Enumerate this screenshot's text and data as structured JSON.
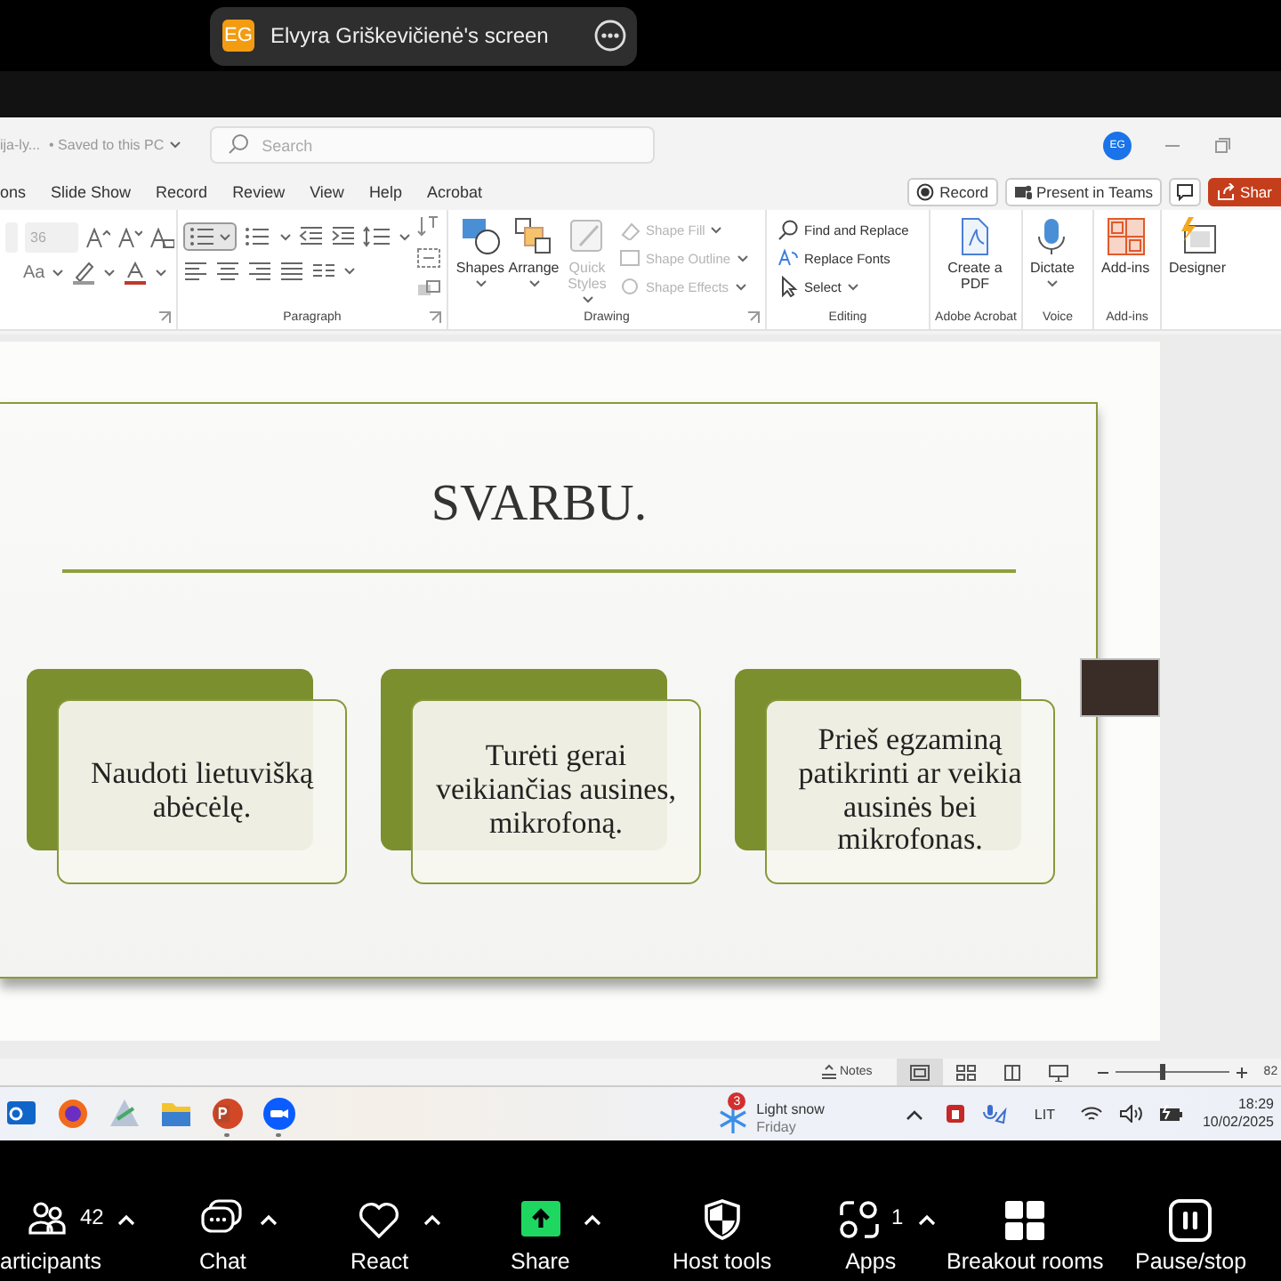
{
  "share_banner": {
    "initials": "EG",
    "title": "Elvyra Griškevičienė's screen"
  },
  "title_bar": {
    "filename": "ija-ly...",
    "save_status": "• Saved to this PC",
    "search": {
      "placeholder": "Search"
    },
    "avatar": "EG"
  },
  "menu_tabs": [
    {
      "label": "ons",
      "selected": false
    },
    {
      "label": "Slide Show",
      "selected": false
    },
    {
      "label": "Record",
      "selected": false
    },
    {
      "label": "Review",
      "selected": false
    },
    {
      "label": "View",
      "selected": false
    },
    {
      "label": "Help",
      "selected": false
    },
    {
      "label": "Acrobat",
      "selected": false
    }
  ],
  "menu_buttons": [
    {
      "kind": "record",
      "label": "Record"
    },
    {
      "kind": "teams",
      "label": "Present in Teams"
    },
    {
      "kind": "comments"
    },
    {
      "kind": "share",
      "label": "Shar"
    }
  ],
  "ribbon": [
    {
      "kind": "font",
      "size": "36",
      "case": "Aa"
    },
    {
      "kind": "paragraph",
      "label": "Paragraph"
    },
    {
      "kind": "drawing",
      "label": "Drawing",
      "large": [
        {
          "label": "Shapes",
          "disabled": false,
          "dropdown": true
        },
        {
          "label": "Arrange",
          "disabled": false,
          "dropdown": true
        },
        {
          "label": "Quick Styles",
          "disabled": true,
          "dropdown": true
        }
      ],
      "small": [
        {
          "label": "Shape Fill",
          "disabled": true,
          "dropdown": true
        },
        {
          "label": "Shape Outline",
          "disabled": true,
          "dropdown": true
        },
        {
          "label": "Shape Effects",
          "disabled": true,
          "dropdown": true
        }
      ]
    },
    {
      "kind": "editing",
      "label": "Editing",
      "small": [
        {
          "label": "Find and Replace",
          "disabled": false,
          "dropdown": false
        },
        {
          "label": "Replace Fonts",
          "disabled": false,
          "dropdown": false
        },
        {
          "label": "Select",
          "disabled": false,
          "dropdown": true
        }
      ]
    },
    {
      "kind": "acrobat",
      "label": "Adobe Acrobat",
      "large": [
        {
          "label": "Create a PDF",
          "disabled": false,
          "dropdown": false
        }
      ]
    },
    {
      "kind": "voice",
      "label": "Voice",
      "large": [
        {
          "label": "Dictate",
          "disabled": false,
          "dropdown": true
        }
      ]
    },
    {
      "kind": "addins",
      "label": "Add-ins",
      "large": [
        {
          "label": "Add-ins",
          "disabled": false,
          "dropdown": false
        }
      ]
    },
    {
      "kind": "designer",
      "large": [
        {
          "label": "Designer",
          "disabled": false,
          "dropdown": false
        }
      ]
    }
  ],
  "slide": {
    "title": "SVARBU.",
    "cards": [
      {
        "text": "Naudoti lietuvišką abėcėlę."
      },
      {
        "text": "Turėti gerai veikiančias ausines, mikrofoną."
      },
      {
        "text": "Prieš egzaminą patikrinti ar veikia ausinės bei mikrofonas."
      }
    ]
  },
  "status_bar": {
    "notes": "Notes",
    "views": [
      {
        "selected": true
      },
      {
        "selected": false
      },
      {
        "selected": false
      },
      {
        "selected": false
      }
    ],
    "zoom": {
      "level": 0.4
    },
    "zoom_text": "82"
  },
  "taskbar": {
    "apps": [
      {
        "running": false
      },
      {
        "running": false
      },
      {
        "running": false
      },
      {
        "running": false
      },
      {
        "running": true
      },
      {
        "running": true
      }
    ],
    "weather": {
      "badge": "3",
      "title": "Light snow",
      "subtitle": "Friday"
    },
    "language": "LIT",
    "time": "18:29",
    "date": "10/02/2025"
  },
  "zoom_toolbar": [
    {
      "kind": "participants",
      "label": "articipants",
      "count": "42",
      "menu": true
    },
    {
      "kind": "chat",
      "label": "Chat",
      "menu": true
    },
    {
      "kind": "react",
      "label": "React",
      "menu": true
    },
    {
      "kind": "share",
      "label": "Share",
      "menu": true
    },
    {
      "kind": "host",
      "label": "Host tools",
      "menu": false
    },
    {
      "kind": "apps",
      "label": "Apps",
      "count": "1",
      "menu": true
    },
    {
      "kind": "breakout",
      "label": "Breakout rooms",
      "menu": false
    },
    {
      "kind": "pause",
      "label": "Pause/stop",
      "menu": false
    }
  ]
}
